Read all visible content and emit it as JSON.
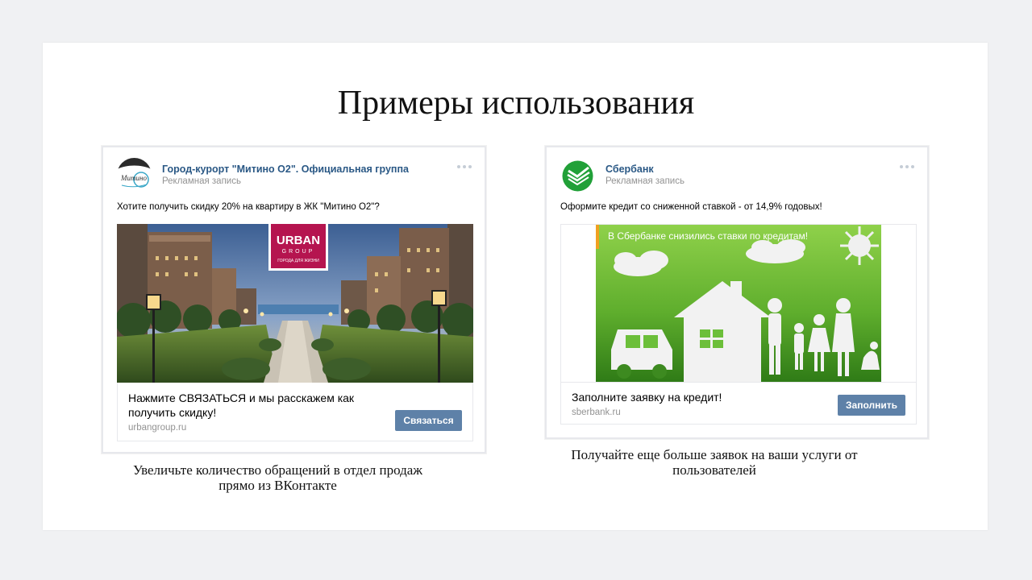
{
  "slide": {
    "title": "Примеры использования"
  },
  "posts": [
    {
      "group_name": "Город-курорт \"Митино О2\". Официальная группа",
      "ad_label": "Рекламная запись",
      "text": "Хотите получить скидку 20% на квартиру в ЖК \"Митино О2\"?",
      "logo_line1": "URBAN",
      "logo_line2": "GROUP",
      "logo_line3": "ГОРОДА ДЛЯ ЖИЗНИ",
      "snippet_title_1": "Нажмите СВЯЗАТЬСЯ и мы расскажем как",
      "snippet_title_2": "получить скидку!",
      "snippet_url": "urbangroup.ru",
      "cta_label": "Связаться",
      "avatar_text": "Митино"
    },
    {
      "group_name": "Сбербанк",
      "ad_label": "Рекламная запись",
      "text": "Оформите кредит со сниженной ставкой - от 14,9% годовых!",
      "banner_text": "В Сбербанке снизились ставки по кредитам!",
      "snippet_title_1": "Заполните заявку на кредит!",
      "snippet_url": "sberbank.ru",
      "cta_label": "Заполнить"
    }
  ],
  "captions": {
    "left_1": "Увеличьте количество обращений в отдел продаж",
    "left_2": "прямо из ВКонтакте",
    "right_1": "Получайте еще больше заявок на ваши услуги от",
    "right_2": "пользователей"
  },
  "colors": {
    "link": "#2a5885",
    "button": "#5e81a8",
    "sber_green": "#21a038",
    "urban_pink": "#b5144f"
  }
}
